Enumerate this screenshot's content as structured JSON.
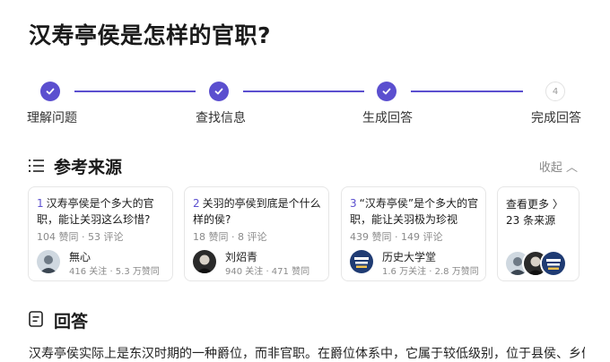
{
  "question": {
    "title": "汉寿亭侯是怎样的官职?"
  },
  "steps": [
    {
      "label": "理解问题",
      "state": "done"
    },
    {
      "label": "查找信息",
      "state": "done"
    },
    {
      "label": "生成回答",
      "state": "done"
    },
    {
      "label": "完成回答",
      "state": "pending",
      "number": "4"
    }
  ],
  "sources": {
    "title": "参考来源",
    "collapse_label": "收起 ︿",
    "cards": [
      {
        "number": "1",
        "title": "汉寿亭侯是个多大的官职，能让关羽这么珍惜?",
        "meta": "104 赞同 · 53 评论",
        "author": "無心",
        "author_stats": "416 关注 · 5.3 万赞同"
      },
      {
        "number": "2",
        "title": "关羽的亭侯到底是个什么样的侯?",
        "meta": "18 赞同 · 8 评论",
        "author": "刘炤青",
        "author_stats": "940 关注 · 471 赞同"
      },
      {
        "number": "3",
        "title": "“汉寿亭侯”是个多大的官职，能让关羽极为珍视",
        "meta": "439 赞同 · 149 评论",
        "author": "历史大学堂",
        "author_stats": "1.6 万关注 · 2.8 万赞同"
      }
    ],
    "more": {
      "label": "查看更多 〉",
      "count": "23 条来源"
    }
  },
  "answer": {
    "title": "回答",
    "text": "汉寿亭侯实际上是东汉时期的一种爵位，而非官职。在爵位体系中，它属于较低级别，位于县侯、乡侯之"
  },
  "colors": {
    "accent": "#5b4fcf",
    "muted": "#8a8a8a",
    "border": "#e6e6e6"
  },
  "icons": {
    "step_done": "check-icon",
    "sources": "list-icon",
    "answer": "document-icon",
    "more": "chevron-right-icon"
  }
}
